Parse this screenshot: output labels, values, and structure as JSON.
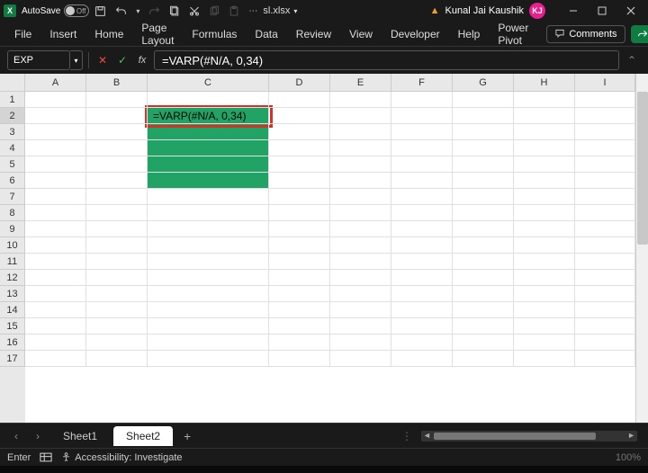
{
  "titlebar": {
    "autosave_label": "AutoSave",
    "autosave_state": "Off",
    "filename": "sl.xlsx",
    "user_name": "Kunal Jai Kaushik",
    "user_initials": "KJ"
  },
  "ribbon": {
    "tabs": [
      "File",
      "Insert",
      "Home",
      "Page Layout",
      "Formulas",
      "Data",
      "Review",
      "View",
      "Developer",
      "Help",
      "Power Pivot"
    ],
    "comments_label": "Comments"
  },
  "formula_bar": {
    "name_box": "EXP",
    "formula": "=VARP(#N/A, 0,34)"
  },
  "sheet": {
    "columns": [
      "A",
      "B",
      "C",
      "D",
      "E",
      "F",
      "G",
      "H",
      "I"
    ],
    "rows": [
      "1",
      "2",
      "3",
      "4",
      "5",
      "6",
      "7",
      "8",
      "9",
      "10",
      "11",
      "12",
      "13",
      "14",
      "15",
      "16",
      "17"
    ],
    "active_cell_text": "=VARP(#N/A, 0,34)"
  },
  "tabs": {
    "sheets": [
      "Sheet1",
      "Sheet2"
    ],
    "active_index": 1
  },
  "statusbar": {
    "mode": "Enter",
    "accessibility": "Accessibility: Investigate",
    "zoom": "100%"
  }
}
